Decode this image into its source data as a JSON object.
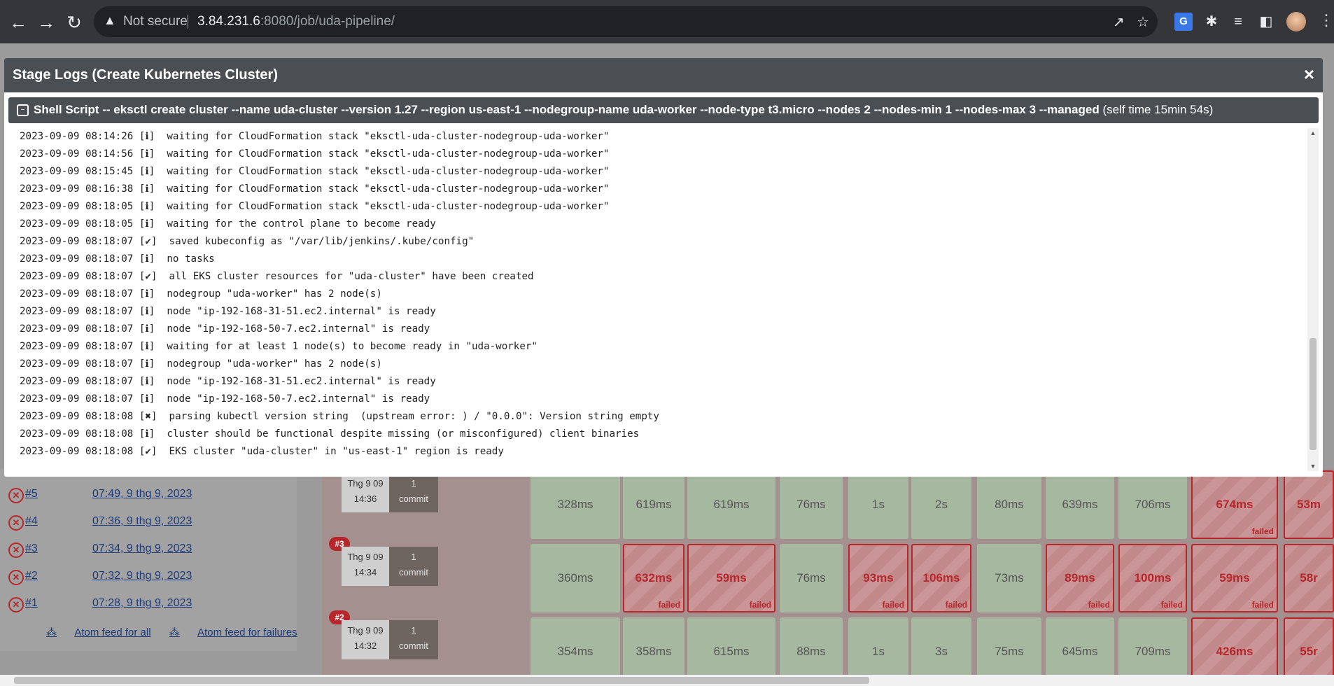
{
  "browser": {
    "security_label": "Not secure",
    "url_host": "3.84.231.6",
    "url_rest": ":8080/job/uda-pipeline/"
  },
  "modal": {
    "title": "Stage Logs (Create Kubernetes Cluster)",
    "close_label": "×",
    "step_description": "Shell Script -- eksctl create cluster --name uda-cluster --version 1.27 --region us-east-1 --nodegroup-name uda-worker --node-type t3.micro --nodes 2 --nodes-min 1 --nodes-max 3 --managed",
    "step_self_time": "(self time 15min 54s)",
    "log_lines": [
      "2023-09-09 08:14:26 [ℹ]  waiting for CloudFormation stack \"eksctl-uda-cluster-nodegroup-uda-worker\"",
      "2023-09-09 08:14:56 [ℹ]  waiting for CloudFormation stack \"eksctl-uda-cluster-nodegroup-uda-worker\"",
      "2023-09-09 08:15:45 [ℹ]  waiting for CloudFormation stack \"eksctl-uda-cluster-nodegroup-uda-worker\"",
      "2023-09-09 08:16:38 [ℹ]  waiting for CloudFormation stack \"eksctl-uda-cluster-nodegroup-uda-worker\"",
      "2023-09-09 08:18:05 [ℹ]  waiting for CloudFormation stack \"eksctl-uda-cluster-nodegroup-uda-worker\"",
      "2023-09-09 08:18:05 [ℹ]  waiting for the control plane to become ready",
      "2023-09-09 08:18:07 [✔]  saved kubeconfig as \"/var/lib/jenkins/.kube/config\"",
      "2023-09-09 08:18:07 [ℹ]  no tasks",
      "2023-09-09 08:18:07 [✔]  all EKS cluster resources for \"uda-cluster\" have been created",
      "2023-09-09 08:18:07 [ℹ]  nodegroup \"uda-worker\" has 2 node(s)",
      "2023-09-09 08:18:07 [ℹ]  node \"ip-192-168-31-51.ec2.internal\" is ready",
      "2023-09-09 08:18:07 [ℹ]  node \"ip-192-168-50-7.ec2.internal\" is ready",
      "2023-09-09 08:18:07 [ℹ]  waiting for at least 1 node(s) to become ready in \"uda-worker\"",
      "2023-09-09 08:18:07 [ℹ]  nodegroup \"uda-worker\" has 2 node(s)",
      "2023-09-09 08:18:07 [ℹ]  node \"ip-192-168-31-51.ec2.internal\" is ready",
      "2023-09-09 08:18:07 [ℹ]  node \"ip-192-168-50-7.ec2.internal\" is ready",
      "2023-09-09 08:18:08 [✖]  parsing kubectl version string  (upstream error: ) / \"0.0.0\": Version string empty",
      "2023-09-09 08:18:08 [ℹ]  cluster should be functional despite missing (or misconfigured) client binaries",
      "2023-09-09 08:18:08 [✔]  EKS cluster \"uda-cluster\" in \"us-east-1\" region is ready"
    ]
  },
  "build_history": [
    {
      "number": "#5",
      "date": "07:49, 9 thg 9, 2023"
    },
    {
      "number": "#4",
      "date": "07:36, 9 thg 9, 2023"
    },
    {
      "number": "#3",
      "date": "07:34, 9 thg 9, 2023"
    },
    {
      "number": "#2",
      "date": "07:32, 9 thg 9, 2023"
    },
    {
      "number": "#1",
      "date": "07:28, 9 thg 9, 2023"
    }
  ],
  "feeds": {
    "all": "Atom feed for all",
    "failures": "Atom feed for failures"
  },
  "stage_rows": [
    {
      "badge": "",
      "date": "Thg 9 09",
      "time": "14:36",
      "commits": "1",
      "commit_word": "commit",
      "cells": [
        {
          "text": "328ms",
          "failed": false
        },
        {
          "text": "619ms",
          "failed": false
        },
        {
          "text": "619ms",
          "failed": false
        },
        {
          "text": "76ms",
          "failed": false
        },
        {
          "text": "1s",
          "failed": false
        },
        {
          "text": "2s",
          "failed": false
        },
        {
          "text": "80ms",
          "failed": false
        },
        {
          "text": "639ms",
          "failed": false
        },
        {
          "text": "706ms",
          "failed": false
        },
        {
          "text": "674ms",
          "failed": true
        },
        {
          "text": "53m",
          "failed": true
        }
      ]
    },
    {
      "badge": "#3",
      "date": "Thg 9 09",
      "time": "14:34",
      "commits": "1",
      "commit_word": "commit",
      "cells": [
        {
          "text": "360ms",
          "failed": false
        },
        {
          "text": "632ms",
          "failed": true
        },
        {
          "text": "59ms",
          "failed": true
        },
        {
          "text": "76ms",
          "failed": false
        },
        {
          "text": "93ms",
          "failed": true
        },
        {
          "text": "106ms",
          "failed": true
        },
        {
          "text": "73ms",
          "failed": false
        },
        {
          "text": "89ms",
          "failed": true
        },
        {
          "text": "100ms",
          "failed": true
        },
        {
          "text": "59ms",
          "failed": true
        },
        {
          "text": "58r",
          "failed": true
        }
      ]
    },
    {
      "badge": "#2",
      "date": "Thg 9 09",
      "time": "14:32",
      "commits": "1",
      "commit_word": "commit",
      "cells": [
        {
          "text": "354ms",
          "failed": false
        },
        {
          "text": "358ms",
          "failed": false
        },
        {
          "text": "615ms",
          "failed": false
        },
        {
          "text": "88ms",
          "failed": false
        },
        {
          "text": "1s",
          "failed": false
        },
        {
          "text": "3s",
          "failed": false
        },
        {
          "text": "75ms",
          "failed": false
        },
        {
          "text": "645ms",
          "failed": false
        },
        {
          "text": "709ms",
          "failed": false
        },
        {
          "text": "426ms",
          "failed": true
        },
        {
          "text": "55r",
          "failed": true
        }
      ]
    }
  ],
  "failed_tag": "failed"
}
